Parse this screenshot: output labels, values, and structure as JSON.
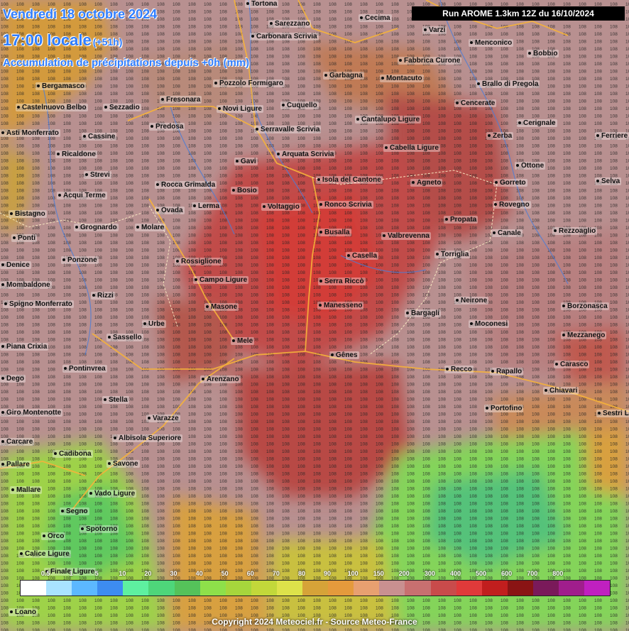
{
  "header": {
    "date": "Vendredi 18 octobre 2024",
    "time": "17:00 locale",
    "offset": "(+51h)",
    "subtitle": "Accumulation de précipitations depuis +0h (mm)",
    "run": "Run AROME 1.3km 12Z du 16/10/2024"
  },
  "towns": [
    {
      "name": "Tortona"
    },
    {
      "name": "Sarezzano"
    },
    {
      "name": "Carbonara Scrivia"
    },
    {
      "name": "Cecima"
    },
    {
      "name": "Varzi"
    },
    {
      "name": "Menconico"
    },
    {
      "name": "Bobbio"
    },
    {
      "name": "Fabbrica Curone"
    },
    {
      "name": "Bergamasco"
    },
    {
      "name": "Pozzolo Formigaro"
    },
    {
      "name": "Garbagna"
    },
    {
      "name": "Montacuto"
    },
    {
      "name": "Brallo di Pregola"
    },
    {
      "name": "Castelnuovo Belbo"
    },
    {
      "name": "Sezzadio"
    },
    {
      "name": "Fresonara"
    },
    {
      "name": "Novi Ligure"
    },
    {
      "name": "Cuquello"
    },
    {
      "name": "Cencerate"
    },
    {
      "name": "Cantalupo Ligure"
    },
    {
      "name": "Cerignale"
    },
    {
      "name": "Predosa"
    },
    {
      "name": "Serravalle Scrivia"
    },
    {
      "name": "Cassine"
    },
    {
      "name": "Zerba"
    },
    {
      "name": "Ferriere"
    },
    {
      "name": "Ricaldone"
    },
    {
      "name": "Cabella Ligure"
    },
    {
      "name": "Arquata Scrivia"
    },
    {
      "name": "Gavi"
    },
    {
      "name": "Ottone"
    },
    {
      "name": "Strevi"
    },
    {
      "name": "Isola del Cantone"
    },
    {
      "name": "Agneto"
    },
    {
      "name": "Gorreto"
    },
    {
      "name": "Selva"
    },
    {
      "name": "Rocca Grimalda"
    },
    {
      "name": "Bosio"
    },
    {
      "name": "Acqui Terme"
    },
    {
      "name": "Lerma"
    },
    {
      "name": "Ronco Scrivia"
    },
    {
      "name": "Rovegno"
    },
    {
      "name": "Voltaggio"
    },
    {
      "name": "Ovada"
    },
    {
      "name": "Bistagno"
    },
    {
      "name": "Propata"
    },
    {
      "name": "Grognardo"
    },
    {
      "name": "Molare"
    },
    {
      "name": "Busalla"
    },
    {
      "name": "Valbrevenna"
    },
    {
      "name": "Canale"
    },
    {
      "name": "Rezzoaglio"
    },
    {
      "name": "Ponti"
    },
    {
      "name": "Torriglia"
    },
    {
      "name": "Casella"
    },
    {
      "name": "Ponzone"
    },
    {
      "name": "Rossiglione"
    },
    {
      "name": "Denice"
    },
    {
      "name": "Campo Ligure"
    },
    {
      "name": "Serra Riccò"
    },
    {
      "name": "Mombaldone"
    },
    {
      "name": "Rizzi"
    },
    {
      "name": "Neirone"
    },
    {
      "name": "Spigno Monferrato"
    },
    {
      "name": "Masone"
    },
    {
      "name": "Manesseno"
    },
    {
      "name": "Borzonasca"
    },
    {
      "name": "Bargagli"
    },
    {
      "name": "Urbe"
    },
    {
      "name": "Moconesi"
    },
    {
      "name": "Mezzanego"
    },
    {
      "name": "Sassello"
    },
    {
      "name": "Mele"
    },
    {
      "name": "Piana Crixia"
    },
    {
      "name": "Gênes"
    },
    {
      "name": "Carasco"
    },
    {
      "name": "Pontinvrea"
    },
    {
      "name": "Recco"
    },
    {
      "name": "Rapallo"
    },
    {
      "name": "Dego"
    },
    {
      "name": "Arenzano"
    },
    {
      "name": "Chiavari"
    },
    {
      "name": "Stella"
    },
    {
      "name": "Portofino"
    },
    {
      "name": "Sestri Le"
    },
    {
      "name": "Giro Montenotte"
    },
    {
      "name": "Varazze"
    },
    {
      "name": "Carcare"
    },
    {
      "name": "Albisola Superiore"
    },
    {
      "name": "Cadibona"
    },
    {
      "name": "Pallare"
    },
    {
      "name": "Savone"
    },
    {
      "name": "Mallare"
    },
    {
      "name": "Vado Ligure"
    },
    {
      "name": "Segno"
    },
    {
      "name": "Orco"
    },
    {
      "name": "Spotorno"
    },
    {
      "name": "Calice Ligure"
    },
    {
      "name": "Finale Ligure"
    },
    {
      "name": "Loano"
    },
    {
      "name": "Asti Monferrato"
    }
  ],
  "legend": {
    "colors": [
      "#ffffff",
      "#a9e3ff",
      "#5cb8ff",
      "#3d8cf0",
      "#5ef0a0",
      "#4ed67a",
      "#55c25a",
      "#8ee04a",
      "#a6d63c",
      "#c2d83a",
      "#dde24a",
      "#d6a338",
      "#e59a3c",
      "#e8a070",
      "#c99090",
      "#c87070",
      "#c94b4b",
      "#e03a3a",
      "#c11e1e",
      "#8a1414",
      "#7a1a5a",
      "#a01e8c",
      "#c020c0"
    ],
    "ticks": [
      "0.5",
      "1",
      "5",
      "10",
      "20",
      "30",
      "40",
      "50",
      "60",
      "70",
      "80",
      "90",
      "100",
      "150",
      "200",
      "300",
      "400",
      "500",
      "600",
      "700",
      "800"
    ]
  },
  "copyright": "Copyright 2024 Meteociel.fr - Source Meteo-France"
}
